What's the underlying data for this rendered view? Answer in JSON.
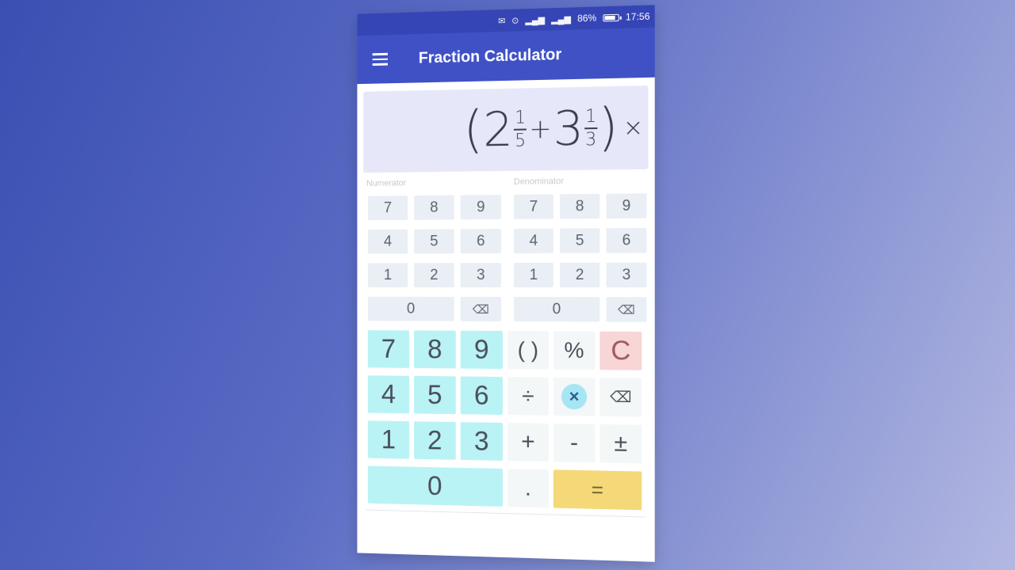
{
  "status_bar": {
    "battery_percent": "86%",
    "battery_level": 0.86,
    "time": "17:56",
    "icons": [
      "message-icon",
      "location-icon",
      "signal-1-icon",
      "signal-2-icon",
      "battery-icon"
    ]
  },
  "app_bar": {
    "title": "Fraction Calculator",
    "menu_icon": "hamburger-menu-icon"
  },
  "display": {
    "open_paren": "(",
    "term1": {
      "whole": "2",
      "numerator": "1",
      "denominator": "5"
    },
    "operator": "+",
    "term2": {
      "whole": "3",
      "numerator": "1",
      "denominator": "3"
    },
    "close_paren": ")",
    "trailing_operator": "×"
  },
  "numerator_pad": {
    "label": "Numerator",
    "keys": [
      "7",
      "8",
      "9",
      "4",
      "5",
      "6",
      "1",
      "2",
      "3",
      "0",
      "⌫"
    ]
  },
  "denominator_pad": {
    "label": "Denominator",
    "keys": [
      "7",
      "8",
      "9",
      "4",
      "5",
      "6",
      "1",
      "2",
      "3",
      "0",
      "⌫"
    ]
  },
  "main_pad": {
    "digits": [
      "7",
      "8",
      "9",
      "4",
      "5",
      "6",
      "1",
      "2",
      "3",
      "0"
    ],
    "parentheses": "( )",
    "percent": "%",
    "clear": "C",
    "divide": "÷",
    "multiply": "×",
    "backspace": "⌫",
    "add": "+",
    "subtract": "-",
    "plus_minus": "±",
    "decimal": ".",
    "equals": "="
  },
  "colors": {
    "app_bar": "#3f51c5",
    "status_bar": "#3645b5",
    "display_bg": "#e6e8fa",
    "digit_key": "#b9f3f6",
    "small_key": "#e9eff4",
    "clear_key": "#f8d5d7",
    "equals_key": "#f5d878",
    "selected_operator": "#a6e6f4"
  }
}
